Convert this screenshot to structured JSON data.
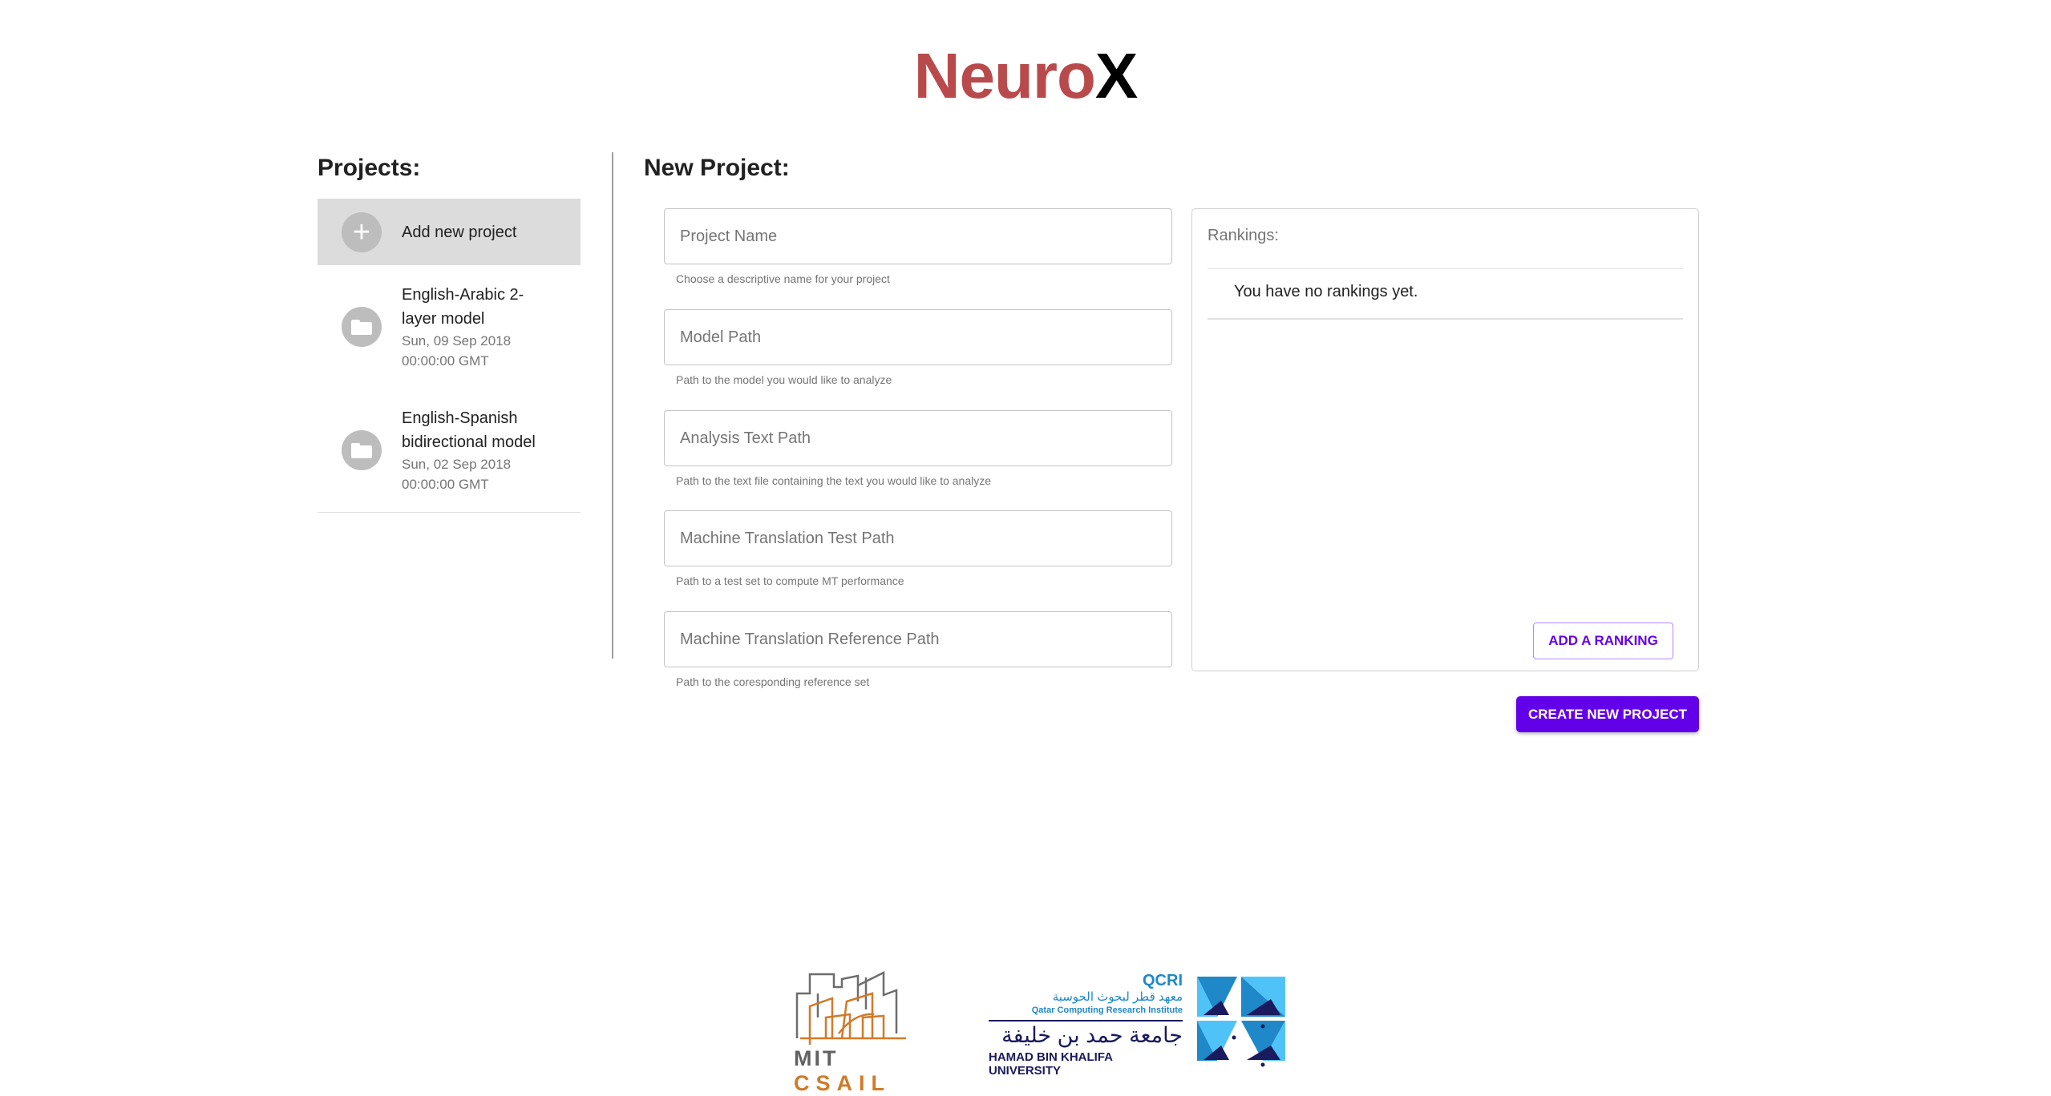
{
  "app": {
    "logo_part1": "Neuro",
    "logo_part2": "X"
  },
  "sidebar": {
    "title": "Projects:",
    "add_label": "Add new project",
    "add_icon": "plus-icon",
    "projects": [
      {
        "name": "English-Arabic 2-layer model",
        "date": "Sun, 09 Sep 2018",
        "time": "00:00:00 GMT",
        "icon": "folder-icon"
      },
      {
        "name": "English-Spanish bidirectional model",
        "date": "Sun, 02 Sep 2018",
        "time": "00:00:00 GMT",
        "icon": "folder-icon"
      }
    ]
  },
  "form": {
    "title": "New Project:",
    "fields": [
      {
        "placeholder": "Project Name",
        "value": "",
        "help": "Choose a descriptive name for your project"
      },
      {
        "placeholder": "Model Path",
        "value": "",
        "help": "Path to the model you would like to analyze"
      },
      {
        "placeholder": "Analysis Text Path",
        "value": "",
        "help": "Path to the text file containing the text you would like to analyze"
      },
      {
        "placeholder": "Machine Translation Test Path",
        "value": "",
        "help": "Path to a test set to compute MT performance"
      },
      {
        "placeholder": "Machine Translation Reference Path",
        "value": "",
        "help": "Path to the coresponding reference set"
      }
    ],
    "create_label": "CREATE NEW PROJECT"
  },
  "rankings": {
    "title": "Rankings:",
    "empty_text": "You have no rankings yet.",
    "add_label": "ADD A RANKING"
  },
  "footer": {
    "mit": "MIT",
    "csail": "CSAIL",
    "qcri": "QCRI",
    "qcri_arabic": "معهد قطر لبحوث الحوسبة",
    "qcri_english": "Qatar Computing Research Institute",
    "hbku_arabic": "جامعة حمد بن خليفة",
    "hbku_english": "HAMAD BIN KHALIFA UNIVERSITY"
  },
  "colors": {
    "brand_red": "#b94a4c",
    "accent_purple": "#6200ea",
    "mit_orange": "#d07a2a",
    "qcri_blue": "#1e88c8",
    "hbku_navy": "#1a1a5e"
  }
}
